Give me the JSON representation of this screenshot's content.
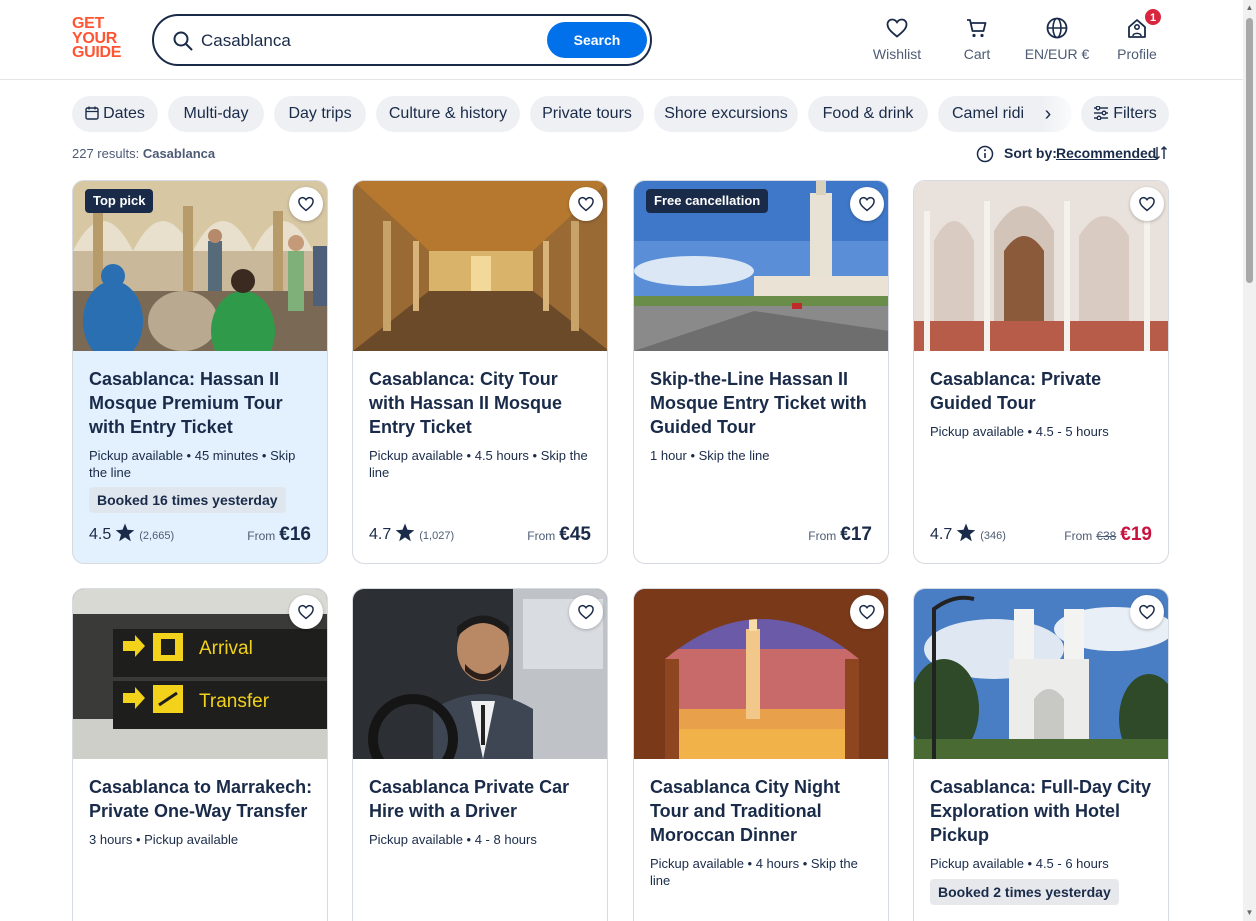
{
  "logo": {
    "line1": "GET",
    "line2": "YOUR",
    "line3": "GUIDE",
    "color": "#ff5533"
  },
  "search": {
    "value": "Casablanca",
    "button_label": "Search",
    "accent": "#0071eb"
  },
  "nav": {
    "wishlist": "Wishlist",
    "cart": "Cart",
    "language": "EN/EUR €",
    "profile": "Profile",
    "profile_badge": "1"
  },
  "chips": [
    "Dates",
    "Multi-day",
    "Day trips",
    "Culture & history",
    "Private tours",
    "Shore excursions",
    "Food & drink",
    "Camel ridi"
  ],
  "filters_label": "Filters",
  "results": {
    "count_text": "227 results:",
    "query": "Casablanca"
  },
  "sort": {
    "label": "Sort by:",
    "value": "Recommended"
  },
  "cards": [
    {
      "tag": "Top pick",
      "title": "Casablanca: Hassan II Mosque Premium Tour with Entry Ticket",
      "meta": "Pickup available • 45 minutes • Skip the line",
      "booked": "Booked 16 times yesterday",
      "rating": "4.5",
      "reviews": "(2,665)",
      "from": "From",
      "old_price": "",
      "price": "€16",
      "sale": false,
      "highlight": true
    },
    {
      "tag": "",
      "title": "Casablanca: City Tour with Hassan II Mosque Entry Ticket",
      "meta": "Pickup available • 4.5 hours • Skip the line",
      "booked": "",
      "rating": "4.7",
      "reviews": "(1,027)",
      "from": "From",
      "old_price": "",
      "price": "€45",
      "sale": false,
      "highlight": false
    },
    {
      "tag": "Free cancellation",
      "title": "Skip-the-Line Hassan II Mosque Entry Ticket with Guided Tour",
      "meta": "1 hour • Skip the line",
      "booked": "",
      "rating": "",
      "reviews": "",
      "from": "From",
      "old_price": "",
      "price": "€17",
      "sale": false,
      "highlight": false
    },
    {
      "tag": "",
      "title": "Casablanca: Private Guided Tour",
      "meta": "Pickup available • 4.5 - 5 hours",
      "booked": "",
      "rating": "4.7",
      "reviews": "(346)",
      "from": "From",
      "old_price": "€38",
      "price": "€19",
      "sale": true,
      "highlight": false
    },
    {
      "tag": "",
      "title": "Casablanca to Marrakech: Private One-Way Transfer",
      "meta": "3 hours • Pickup available",
      "booked": "",
      "image_text_1": "Arrival",
      "image_text_2": "Transfer"
    },
    {
      "tag": "",
      "title": "Casablanca Private Car Hire with a Driver",
      "meta": "Pickup available • 4 - 8 hours",
      "booked": ""
    },
    {
      "tag": "",
      "title": "Casablanca City Night Tour and Traditional Moroccan Dinner",
      "meta": "Pickup available • 4 hours • Skip the line",
      "booked": ""
    },
    {
      "tag": "",
      "title": "Casablanca: Full-Day City Exploration with Hotel Pickup",
      "meta": "Pickup available • 4.5 - 6 hours",
      "booked": "Booked 2 times yesterday"
    }
  ],
  "colors": {
    "text": "#1a2b49",
    "muted": "#4d5b74",
    "sale": "#c6143f",
    "chip_bg": "#eef0f3",
    "highlight_bg": "#e3f0fd",
    "badge": "#d7263d"
  }
}
